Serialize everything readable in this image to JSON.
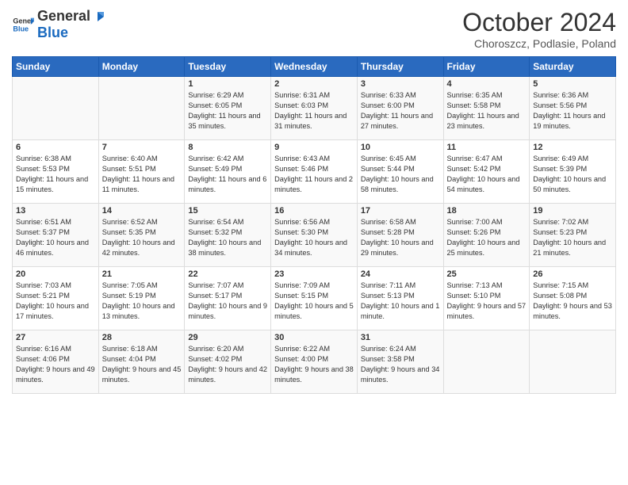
{
  "header": {
    "logo_general": "General",
    "logo_blue": "Blue",
    "month_title": "October 2024",
    "location": "Choroszcz, Podlasie, Poland"
  },
  "days_of_week": [
    "Sunday",
    "Monday",
    "Tuesday",
    "Wednesday",
    "Thursday",
    "Friday",
    "Saturday"
  ],
  "weeks": [
    [
      {
        "day": "",
        "info": ""
      },
      {
        "day": "",
        "info": ""
      },
      {
        "day": "1",
        "info": "Sunrise: 6:29 AM\nSunset: 6:05 PM\nDaylight: 11 hours and 35 minutes."
      },
      {
        "day": "2",
        "info": "Sunrise: 6:31 AM\nSunset: 6:03 PM\nDaylight: 11 hours and 31 minutes."
      },
      {
        "day": "3",
        "info": "Sunrise: 6:33 AM\nSunset: 6:00 PM\nDaylight: 11 hours and 27 minutes."
      },
      {
        "day": "4",
        "info": "Sunrise: 6:35 AM\nSunset: 5:58 PM\nDaylight: 11 hours and 23 minutes."
      },
      {
        "day": "5",
        "info": "Sunrise: 6:36 AM\nSunset: 5:56 PM\nDaylight: 11 hours and 19 minutes."
      }
    ],
    [
      {
        "day": "6",
        "info": "Sunrise: 6:38 AM\nSunset: 5:53 PM\nDaylight: 11 hours and 15 minutes."
      },
      {
        "day": "7",
        "info": "Sunrise: 6:40 AM\nSunset: 5:51 PM\nDaylight: 11 hours and 11 minutes."
      },
      {
        "day": "8",
        "info": "Sunrise: 6:42 AM\nSunset: 5:49 PM\nDaylight: 11 hours and 6 minutes."
      },
      {
        "day": "9",
        "info": "Sunrise: 6:43 AM\nSunset: 5:46 PM\nDaylight: 11 hours and 2 minutes."
      },
      {
        "day": "10",
        "info": "Sunrise: 6:45 AM\nSunset: 5:44 PM\nDaylight: 10 hours and 58 minutes."
      },
      {
        "day": "11",
        "info": "Sunrise: 6:47 AM\nSunset: 5:42 PM\nDaylight: 10 hours and 54 minutes."
      },
      {
        "day": "12",
        "info": "Sunrise: 6:49 AM\nSunset: 5:39 PM\nDaylight: 10 hours and 50 minutes."
      }
    ],
    [
      {
        "day": "13",
        "info": "Sunrise: 6:51 AM\nSunset: 5:37 PM\nDaylight: 10 hours and 46 minutes."
      },
      {
        "day": "14",
        "info": "Sunrise: 6:52 AM\nSunset: 5:35 PM\nDaylight: 10 hours and 42 minutes."
      },
      {
        "day": "15",
        "info": "Sunrise: 6:54 AM\nSunset: 5:32 PM\nDaylight: 10 hours and 38 minutes."
      },
      {
        "day": "16",
        "info": "Sunrise: 6:56 AM\nSunset: 5:30 PM\nDaylight: 10 hours and 34 minutes."
      },
      {
        "day": "17",
        "info": "Sunrise: 6:58 AM\nSunset: 5:28 PM\nDaylight: 10 hours and 29 minutes."
      },
      {
        "day": "18",
        "info": "Sunrise: 7:00 AM\nSunset: 5:26 PM\nDaylight: 10 hours and 25 minutes."
      },
      {
        "day": "19",
        "info": "Sunrise: 7:02 AM\nSunset: 5:23 PM\nDaylight: 10 hours and 21 minutes."
      }
    ],
    [
      {
        "day": "20",
        "info": "Sunrise: 7:03 AM\nSunset: 5:21 PM\nDaylight: 10 hours and 17 minutes."
      },
      {
        "day": "21",
        "info": "Sunrise: 7:05 AM\nSunset: 5:19 PM\nDaylight: 10 hours and 13 minutes."
      },
      {
        "day": "22",
        "info": "Sunrise: 7:07 AM\nSunset: 5:17 PM\nDaylight: 10 hours and 9 minutes."
      },
      {
        "day": "23",
        "info": "Sunrise: 7:09 AM\nSunset: 5:15 PM\nDaylight: 10 hours and 5 minutes."
      },
      {
        "day": "24",
        "info": "Sunrise: 7:11 AM\nSunset: 5:13 PM\nDaylight: 10 hours and 1 minute."
      },
      {
        "day": "25",
        "info": "Sunrise: 7:13 AM\nSunset: 5:10 PM\nDaylight: 9 hours and 57 minutes."
      },
      {
        "day": "26",
        "info": "Sunrise: 7:15 AM\nSunset: 5:08 PM\nDaylight: 9 hours and 53 minutes."
      }
    ],
    [
      {
        "day": "27",
        "info": "Sunrise: 6:16 AM\nSunset: 4:06 PM\nDaylight: 9 hours and 49 minutes."
      },
      {
        "day": "28",
        "info": "Sunrise: 6:18 AM\nSunset: 4:04 PM\nDaylight: 9 hours and 45 minutes."
      },
      {
        "day": "29",
        "info": "Sunrise: 6:20 AM\nSunset: 4:02 PM\nDaylight: 9 hours and 42 minutes."
      },
      {
        "day": "30",
        "info": "Sunrise: 6:22 AM\nSunset: 4:00 PM\nDaylight: 9 hours and 38 minutes."
      },
      {
        "day": "31",
        "info": "Sunrise: 6:24 AM\nSunset: 3:58 PM\nDaylight: 9 hours and 34 minutes."
      },
      {
        "day": "",
        "info": ""
      },
      {
        "day": "",
        "info": ""
      }
    ]
  ]
}
